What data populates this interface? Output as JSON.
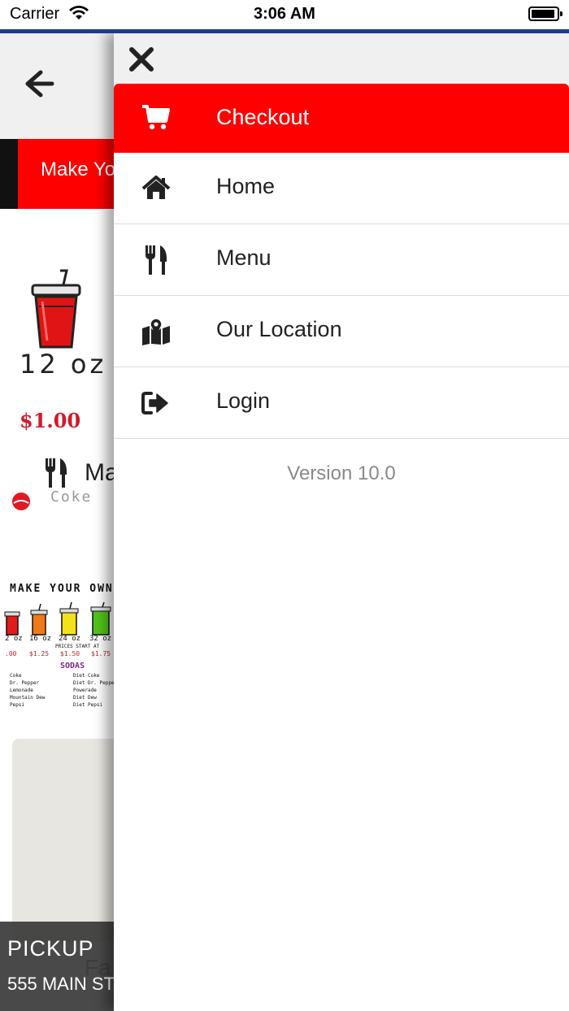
{
  "status_bar": {
    "carrier": "Carrier",
    "time": "3:06 AM"
  },
  "background_page": {
    "banner_text": "Make Yo",
    "cup_size": "12 oz",
    "cup_price": "$1.00",
    "menu_heading": "Ma",
    "coke_label": "Coke",
    "poster": {
      "title": "MAKE YOUR OWN",
      "sizes": [
        "2 oz",
        "16 oz",
        "24 oz",
        "32 oz"
      ],
      "prices": [
        ".00",
        "$1.25",
        "$1.50",
        "$1.75"
      ],
      "note": "PRICES START AT",
      "sodas_title": "SODAS",
      "sodas_left": [
        "Coke",
        "Dr. Pepper",
        "Lemonade",
        "Mountain Dew",
        "Pepsi"
      ],
      "sodas_right": [
        "Diet Coke",
        "Diet Dr. Pepper",
        "Powerade",
        "Diet Dew",
        "Diet Pepsi"
      ],
      "colors": [
        "#e31b1b",
        "#f07a1a",
        "#f3e21a",
        "#52c41a"
      ]
    },
    "pickup_title": "PICKUP",
    "pickup_address": "555 MAIN ST",
    "fav_text": "Fa"
  },
  "drawer": {
    "items": [
      {
        "label": "Checkout",
        "icon": "cart-icon",
        "active": true
      },
      {
        "label": "Home",
        "icon": "home-icon",
        "active": false
      },
      {
        "label": "Menu",
        "icon": "utensils-icon",
        "active": false
      },
      {
        "label": "Our Location",
        "icon": "map-icon",
        "active": false
      },
      {
        "label": "Login",
        "icon": "sign-in-icon",
        "active": false
      }
    ],
    "version": "Version 10.0"
  },
  "colors": {
    "accent_red": "#ff0000",
    "header_gray": "#f0f0f0",
    "status_blue": "#1e3c8c"
  }
}
